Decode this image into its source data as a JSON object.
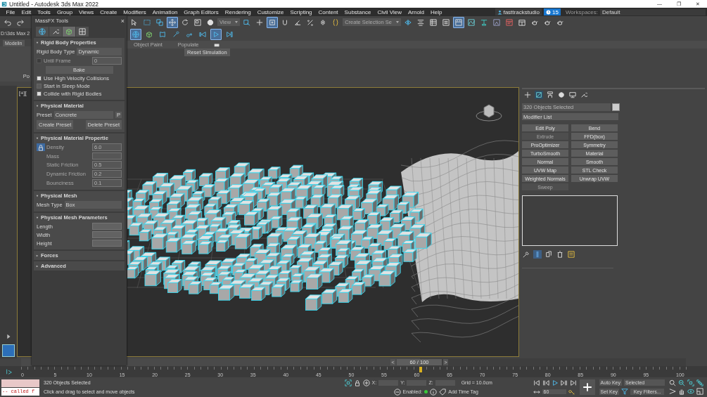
{
  "window": {
    "title": "Untitled - Autodesk 3ds Max 2022",
    "controls": [
      "—",
      "❐",
      "✕"
    ]
  },
  "menu": [
    "File",
    "Edit",
    "Tools",
    "Group",
    "Views",
    "Create",
    "Modifiers",
    "Animation",
    "Graph Editors",
    "Rendering",
    "Customize",
    "Scripting",
    "Content",
    "Substance",
    "Civil View",
    "Arnold",
    "Help"
  ],
  "account": {
    "user": "fasttrackstudio",
    "badge": "15",
    "workspaces_label": "Workspaces:",
    "workspace": "Default"
  },
  "history": [
    {
      "kind": "undo",
      "selected": false
    },
    {
      "kind": "redo",
      "selected": false
    }
  ],
  "toolbar_main": [
    {
      "kind": "select",
      "selected": false
    },
    {
      "kind": "rect",
      "selected": false
    },
    {
      "kind": "crossing",
      "selected": false
    },
    {
      "kind": "move",
      "selected": true
    },
    {
      "kind": "rotate",
      "selected": false
    },
    {
      "kind": "scale",
      "selected": false
    },
    {
      "kind": "sphere",
      "selected": false
    },
    {
      "kind": "dropdown",
      "label": "View"
    },
    {
      "kind": "pivot",
      "selected": false
    },
    {
      "kind": "crosshair",
      "selected": false
    },
    {
      "kind": "square",
      "selected": true
    },
    {
      "kind": "snap",
      "selected": false
    },
    {
      "kind": "angle",
      "selected": false
    },
    {
      "kind": "percent",
      "selected": false
    },
    {
      "kind": "spinner",
      "selected": false
    },
    {
      "kind": "braces",
      "selected": false
    },
    {
      "kind": "dropdown",
      "label": "Create Selection Se"
    },
    {
      "kind": "mirror",
      "selected": false
    },
    {
      "kind": "align",
      "selected": false
    },
    {
      "kind": "list",
      "selected": false
    },
    {
      "kind": "layers",
      "selected": false
    },
    {
      "kind": "ribbon",
      "selected": true
    },
    {
      "kind": "curve",
      "selected": false
    },
    {
      "kind": "schematic",
      "selected": false
    },
    {
      "kind": "material",
      "selected": false
    },
    {
      "kind": "rsetup",
      "selected": false
    },
    {
      "kind": "frame",
      "selected": false
    },
    {
      "kind": "teapot",
      "selected": false
    },
    {
      "kind": "teapot",
      "selected": false
    },
    {
      "kind": "teapot",
      "selected": false
    }
  ],
  "toolbar_massfx": [
    {
      "kind": "world",
      "selected": true
    },
    {
      "kind": "rigid",
      "selected": false
    },
    {
      "kind": "cloth",
      "selected": false
    },
    {
      "kind": "brush",
      "selected": false
    },
    {
      "kind": "ball",
      "selected": false
    },
    {
      "kind": "reset",
      "selected": false
    },
    {
      "kind": "play",
      "selected": true
    },
    {
      "kind": "step",
      "selected": false
    }
  ],
  "ribbon": {
    "path": "D:\\3ds Max 2",
    "tab": "Modelin",
    "group": "Po",
    "tabs": [
      "Object Paint",
      "Populate"
    ]
  },
  "tooltip": "Reset Simulation",
  "massfx": {
    "title": "MassFX Tools",
    "close": "×",
    "tabs": [
      {
        "kind": "world",
        "selected": false
      },
      {
        "kind": "wrench",
        "selected": false
      },
      {
        "kind": "rigid",
        "selected": true
      },
      {
        "kind": "checker",
        "selected": false
      }
    ],
    "rollouts": [
      {
        "title": "Rigid Body Properties",
        "expanded": true,
        "rows": [
          {
            "kind": "dropdown",
            "label": "Rigid Body Type",
            "value": "Dynamic"
          },
          {
            "kind": "checkbox_spinner",
            "label": "Until Frame",
            "checked": false,
            "disabled": true,
            "value": "0"
          },
          {
            "kind": "button",
            "label": "Bake"
          },
          {
            "kind": "checkbox",
            "label": "Use High Velocity Collisions",
            "checked": true
          },
          {
            "kind": "checkbox",
            "label": "Start in Sleep Mode",
            "checked": false
          },
          {
            "kind": "checkbox",
            "label": "Collide with Rigid Bodies",
            "checked": true
          }
        ]
      },
      {
        "title": "Physical Material",
        "expanded": true,
        "rows": [
          {
            "kind": "dropdown_button",
            "label": "Preset",
            "value": "Concrete",
            "button": "P"
          },
          {
            "kind": "button_pair",
            "labels": [
              "Create Preset",
              "Delete Preset"
            ]
          }
        ]
      },
      {
        "title": "Physical Material Propertie",
        "expanded": true,
        "lock": {
          "selected": true
        },
        "rows": [
          {
            "kind": "spinner",
            "label": "Density",
            "value": "6.0",
            "disabled": true
          },
          {
            "kind": "spinner",
            "label": "Mass",
            "disabled": true
          },
          {
            "kind": "spinner",
            "label": "Static Friction",
            "value": "0.5",
            "disabled": true
          },
          {
            "kind": "spinner",
            "label": "Dynamic Friction",
            "value": "0.2",
            "disabled": true
          },
          {
            "kind": "spinner",
            "label": "Bounciness",
            "value": "0.1",
            "disabled": true
          }
        ]
      },
      {
        "title": "Physical Mesh",
        "expanded": true,
        "rows": [
          {
            "kind": "dropdown",
            "label": "Mesh Type",
            "value": "Box"
          }
        ]
      },
      {
        "title": "Physical Mesh Parameters",
        "expanded": true,
        "rows": [
          {
            "kind": "spinner",
            "label": "Length",
            "disabled": false
          },
          {
            "kind": "spinner",
            "label": "Width",
            "disabled": false
          },
          {
            "kind": "spinner",
            "label": "Height",
            "disabled": false
          }
        ]
      },
      {
        "title": "Forces",
        "expanded": false
      },
      {
        "title": "Advanced",
        "expanded": false
      }
    ]
  },
  "viewport": {
    "label": "[+]["
  },
  "command_panel": {
    "tabs": [
      {
        "kind": "plus",
        "selected": false
      },
      {
        "kind": "modify",
        "selected": true
      },
      {
        "kind": "hierarchy",
        "selected": false
      },
      {
        "kind": "motion",
        "selected": false
      },
      {
        "kind": "display",
        "selected": false
      },
      {
        "kind": "wrench",
        "selected": false
      }
    ],
    "name_field": "320 Objects Selected",
    "modifier_list": "Modifier List",
    "modifiers": [
      {
        "label": "Edit Poly",
        "disabled": false
      },
      {
        "label": "Bend",
        "disabled": false
      },
      {
        "label": "Extrude",
        "disabled": true
      },
      {
        "label": "FFD(box)",
        "disabled": false
      },
      {
        "label": "ProOptimizer",
        "disabled": false
      },
      {
        "label": "Symmetry",
        "disabled": false
      },
      {
        "label": "TurboSmooth",
        "disabled": false
      },
      {
        "label": "Material",
        "disabled": false
      },
      {
        "label": "Normal",
        "disabled": false
      },
      {
        "label": "Smooth",
        "disabled": false
      },
      {
        "label": "UVW Map",
        "disabled": false
      },
      {
        "label": "STL Check",
        "disabled": false
      },
      {
        "label": "Weighted Normals",
        "disabled": false
      },
      {
        "label": "Unwrap UVW",
        "disabled": false
      },
      {
        "label": "Sweep",
        "disabled": true
      }
    ],
    "stack_tools": [
      {
        "kind": "pin",
        "selected": false
      },
      {
        "kind": "pipe",
        "selected": true
      },
      {
        "kind": "unique",
        "selected": false
      },
      {
        "kind": "trash",
        "selected": false
      },
      {
        "kind": "configure",
        "selected": false
      }
    ]
  },
  "timeline": {
    "position": "60 / 100",
    "prev": "<",
    "next": ">",
    "level": 0.6,
    "ticks": [
      "0",
      "5",
      "10",
      "15",
      "20",
      "25",
      "30",
      "35",
      "40",
      "45",
      "50",
      "55",
      "60",
      "65",
      "70",
      "75",
      "80",
      "85",
      "90",
      "95",
      "100"
    ]
  },
  "status": {
    "listener": "-- called f",
    "selection": "320 Objects Selected",
    "prompt": "Click and drag to select and move objects",
    "coords": [
      {
        "label": "X:"
      },
      {
        "label": "Y:"
      },
      {
        "label": "Z:"
      }
    ],
    "grid": "Grid = 10.0cm",
    "enabled_label": "Enabled:",
    "enabled": true,
    "time_tag": "Add Time Tag",
    "frame": "60",
    "auto_key": "Auto Key",
    "set_key": "Set Key",
    "key_mode": "Selected",
    "key_filters": "Key Filters..."
  }
}
